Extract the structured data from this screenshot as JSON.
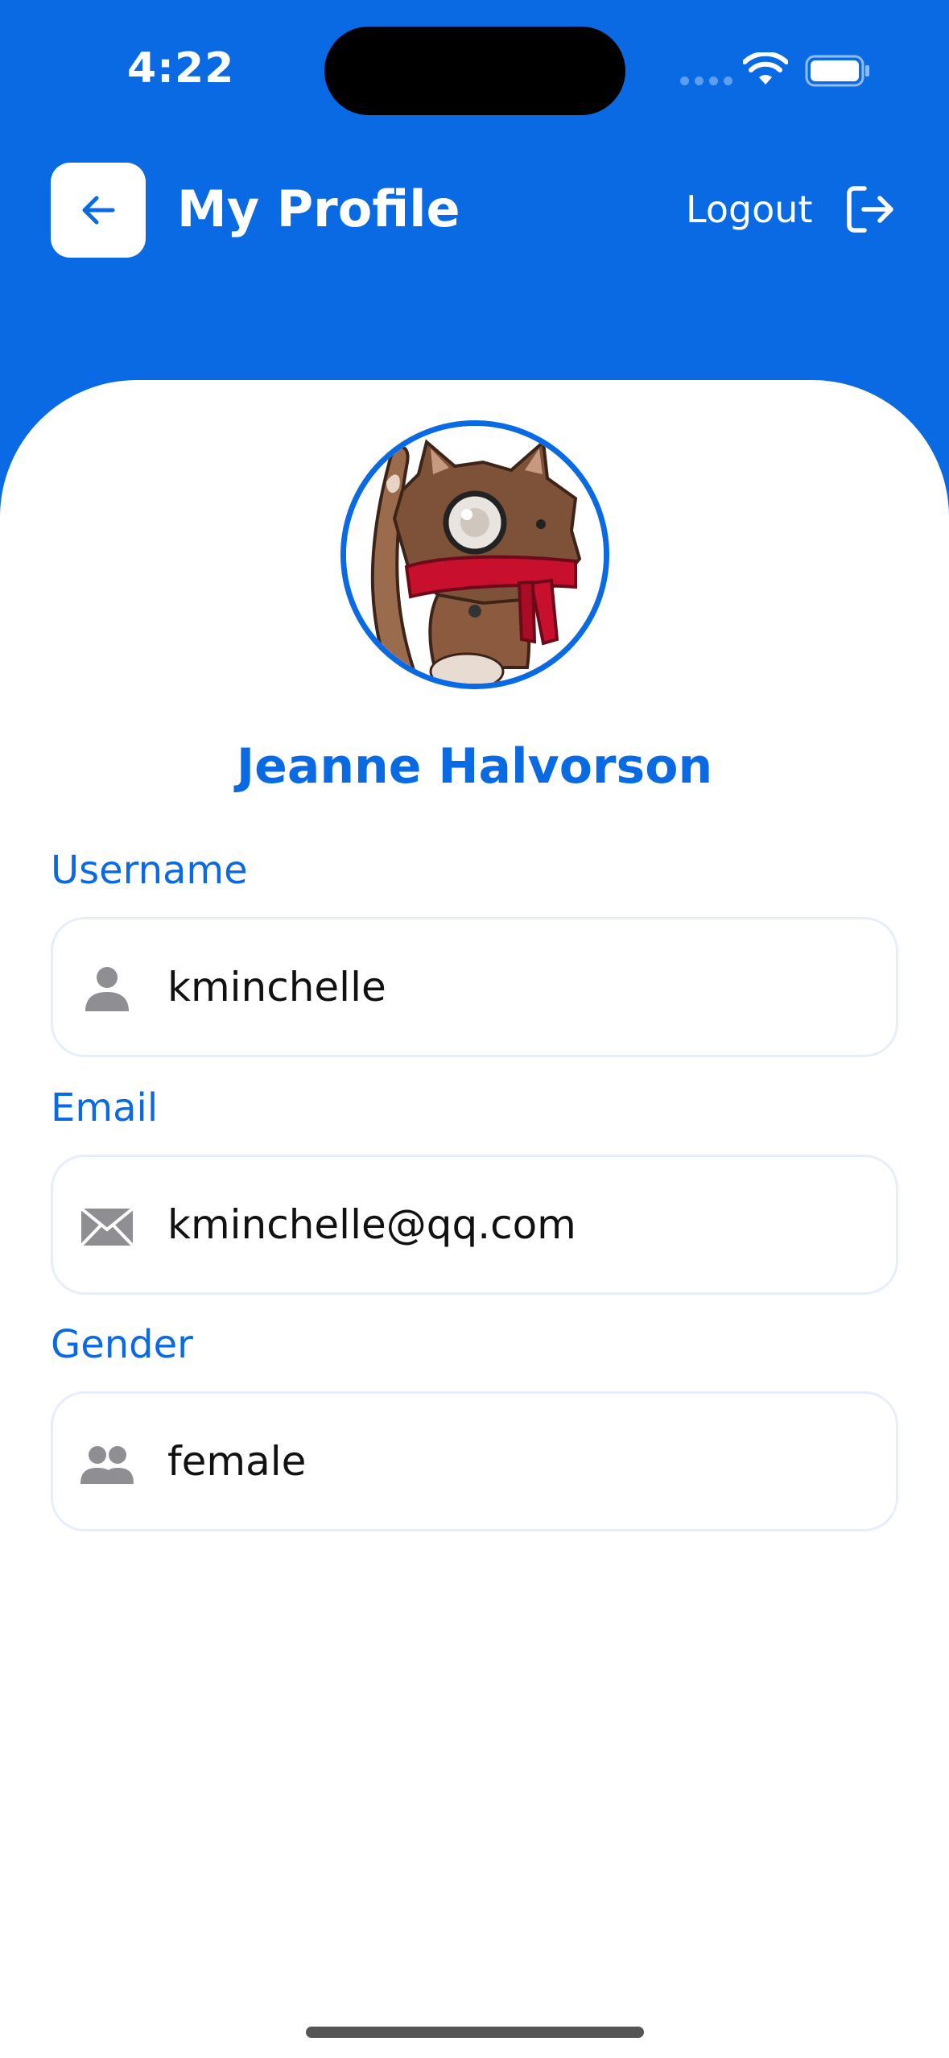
{
  "status_bar": {
    "time": "4:22"
  },
  "header": {
    "title": "My Profile",
    "back_icon": "arrow-left-icon",
    "logout_label": "Logout",
    "logout_icon": "logout-icon"
  },
  "profile": {
    "full_name": "Jeanne Halvorson",
    "avatar_icon": "cat-avatar-image"
  },
  "fields": [
    {
      "label": "Username",
      "value": "kminchelle",
      "icon": "person-icon"
    },
    {
      "label": "Email",
      "value": "kminchelle@qq.com",
      "icon": "mail-icon"
    },
    {
      "label": "Gender",
      "value": "female",
      "icon": "people-icon"
    }
  ],
  "colors": {
    "primary": "#0a6ae4",
    "background": "#ffffff",
    "field_border": "#e6eef9",
    "icon_gray": "#8e8e93",
    "text": "#111111"
  }
}
